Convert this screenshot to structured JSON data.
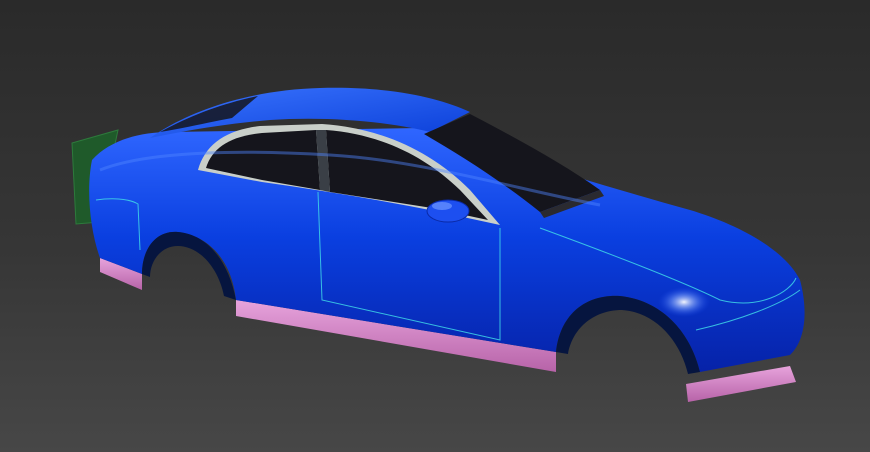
{
  "scene": {
    "kind": "3d-viewport",
    "subject": "car-body-model",
    "colors": {
      "background_top": "#2a2a2a",
      "background_bottom": "#474747",
      "body_paint": "#0a3fe0",
      "body_shadow": "#0622a8",
      "body_highlight": "#4f86ff",
      "window_glass": "#15151c",
      "window_trim": "#c9cfc9",
      "sill_panel": "#d97fc7",
      "rear_patch": "#1f5a2a",
      "edge_lines": "#3fd8e8"
    }
  }
}
